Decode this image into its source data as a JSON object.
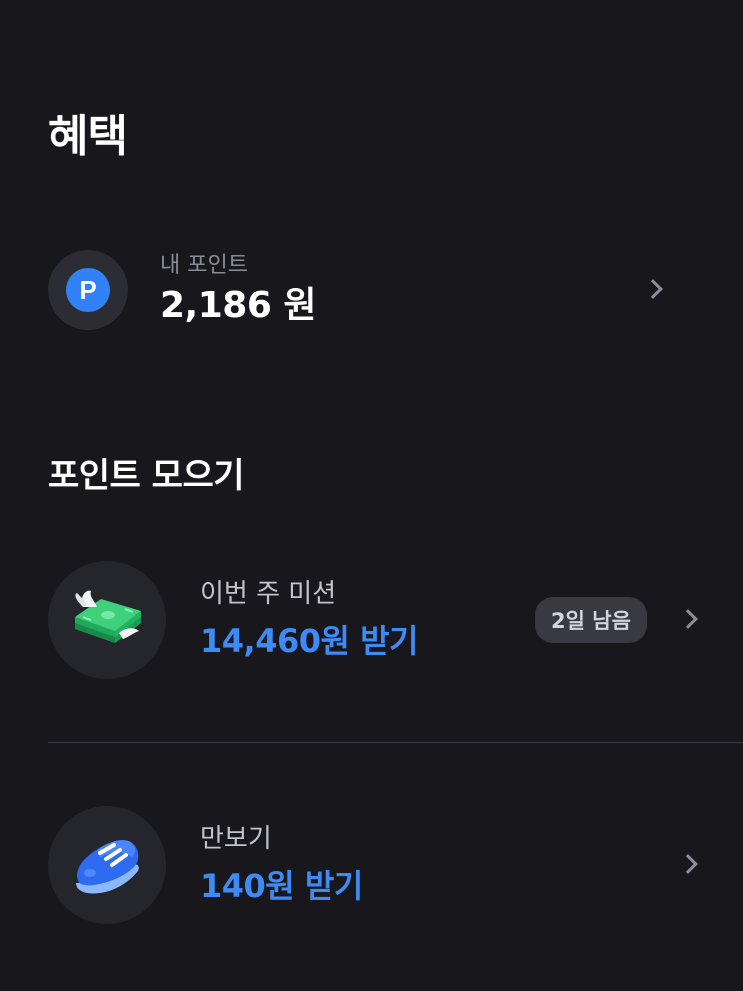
{
  "page": {
    "title": "혜택"
  },
  "my_points": {
    "label": "내 포인트",
    "value": "2,186 원",
    "badge_letter": "P",
    "badge_color": "#3182f6"
  },
  "collect": {
    "title": "포인트 모으기",
    "items": [
      {
        "icon": "flying-money-icon",
        "label": "이번 주 미션",
        "reward": "14,460원 받기",
        "badge": "2일 남음"
      },
      {
        "icon": "sneaker-icon",
        "label": "만보기",
        "reward": "140원 받기"
      }
    ]
  },
  "colors": {
    "background": "#17171c",
    "accent": "#3d8bf7"
  }
}
